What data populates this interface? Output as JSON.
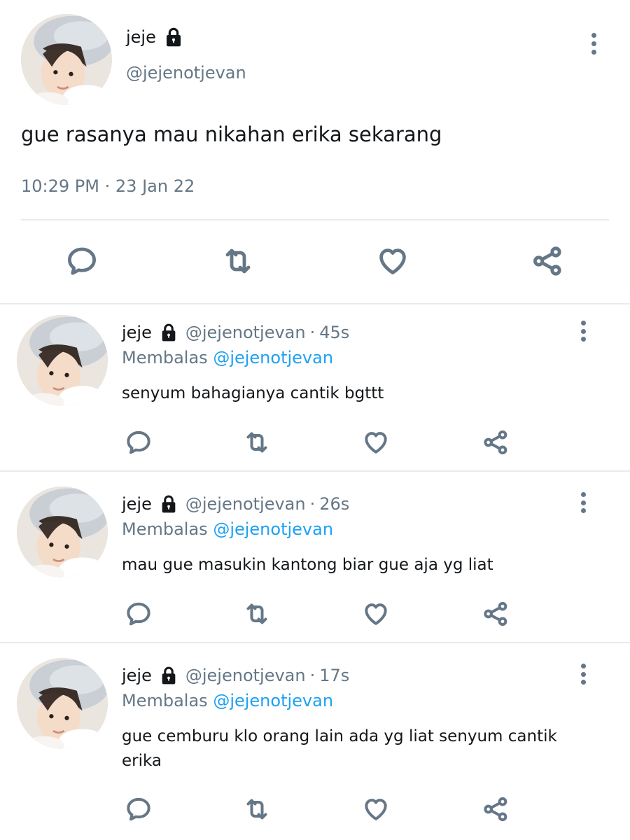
{
  "main_tweet": {
    "display_name": "jeje",
    "handle": "@jejenotjevan",
    "text": "gue rasanya mau nikahan erika sekarang",
    "time": "10:29 PM",
    "date": "23 Jan 22",
    "separator": "·"
  },
  "replies": [
    {
      "display_name": "jeje",
      "handle": "@jejenotjevan",
      "age": "45s",
      "replying_label": "Membalas",
      "replying_to": "@jejenotjevan",
      "text": "senyum bahagianya cantik bgttt"
    },
    {
      "display_name": "jeje",
      "handle": "@jejenotjevan",
      "age": "26s",
      "replying_label": "Membalas",
      "replying_to": "@jejenotjevan",
      "text": "mau gue masukin kantong biar gue aja yg liat"
    },
    {
      "display_name": "jeje",
      "handle": "@jejenotjevan",
      "age": "17s",
      "replying_label": "Membalas",
      "replying_to": "@jejenotjevan",
      "text": "gue cemburu klo orang lain ada yg liat senyum cantik erika"
    }
  ],
  "icons": {
    "reply": "reply-icon",
    "retweet": "retweet-icon",
    "like": "heart-icon",
    "share": "share-icon",
    "protected": "lock-icon",
    "more": "more-vertical-icon"
  },
  "colors": {
    "text": "#14171a",
    "secondary": "#657786",
    "mention": "#1da1f2",
    "divider": "#e6ecf0"
  }
}
